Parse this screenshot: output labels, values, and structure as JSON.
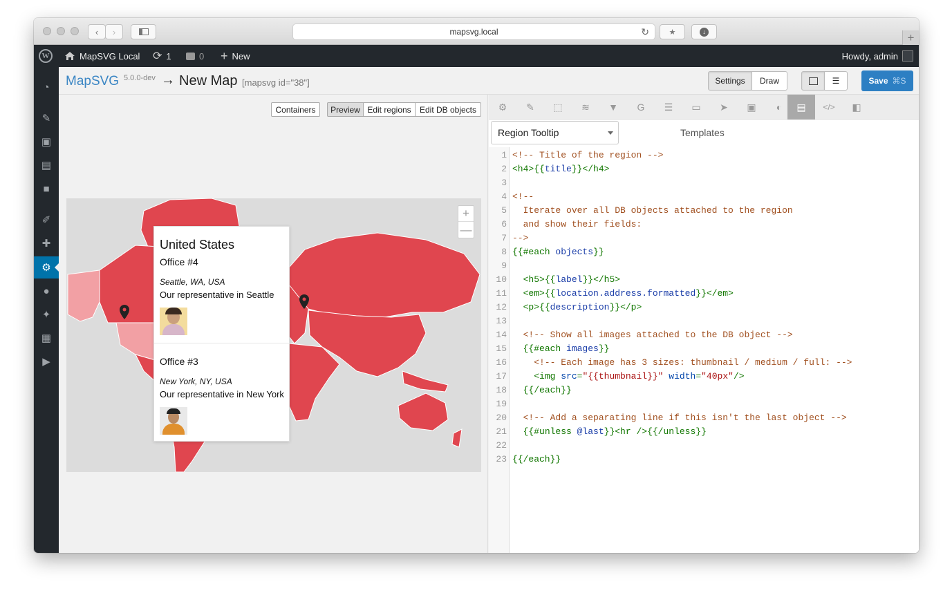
{
  "browser": {
    "url": "mapsvg.local"
  },
  "admin_bar": {
    "site_name": "MapSVG Local",
    "updates_count": "1",
    "comments_count": "0",
    "new_label": "New",
    "howdy": "Howdy, admin"
  },
  "header": {
    "logo": "MapSVG",
    "version": "5.0.0-dev",
    "arrow": "→",
    "title": "New Map",
    "shortcode": "[mapsvg id=\"38\"]",
    "settings_label": "Settings",
    "draw_label": "Draw",
    "save_label": "Save",
    "save_shortcut": "⌘S"
  },
  "preview_toolbar": {
    "containers_label": "Containers",
    "preview_label": "Preview",
    "edit_regions_label": "Edit regions",
    "edit_db_label": "Edit DB objects"
  },
  "map": {
    "zoom_in": "+",
    "zoom_out": "—"
  },
  "tooltip": {
    "region_title": "United States",
    "objects": [
      {
        "label": "Office #4",
        "address": "Seattle, WA, USA",
        "description": "Our representative in Seattle"
      },
      {
        "label": "Office #3",
        "address": "New York, NY, USA",
        "description": "Our representative in New York"
      }
    ]
  },
  "editor": {
    "template_select": "Region Tooltip",
    "templates_label": "Templates",
    "lines": [
      "<!-- Title of the region -->",
      "<h4>{{title}}</h4>",
      "",
      "<!--",
      "  Iterate over all DB objects attached to the region",
      "  and show their fields:",
      "-->",
      "{{#each objects}}",
      "",
      "  <h5>{{label}}</h5>",
      "  <em>{{location.address.formatted}}</em>",
      "  <p>{{description}}</p>",
      "",
      "  <!-- Show all images attached to the DB object -->",
      "  {{#each images}}",
      "    <!-- Each image has 3 sizes: thumbnail / medium / full: -->",
      "    <img src=\"{{thumbnail}}\" width=\"40px\"/>",
      "  {{/each}}",
      "",
      "  <!-- Add a separating line if this isn't the last object -->",
      "  {{#unless @last}}<hr />{{/unless}}",
      "",
      "{{/each}}"
    ]
  },
  "colors": {
    "accent": "#0073aa",
    "region": "#e0464f",
    "region_light": "#f2a0a4",
    "save": "#2d7fc3"
  }
}
